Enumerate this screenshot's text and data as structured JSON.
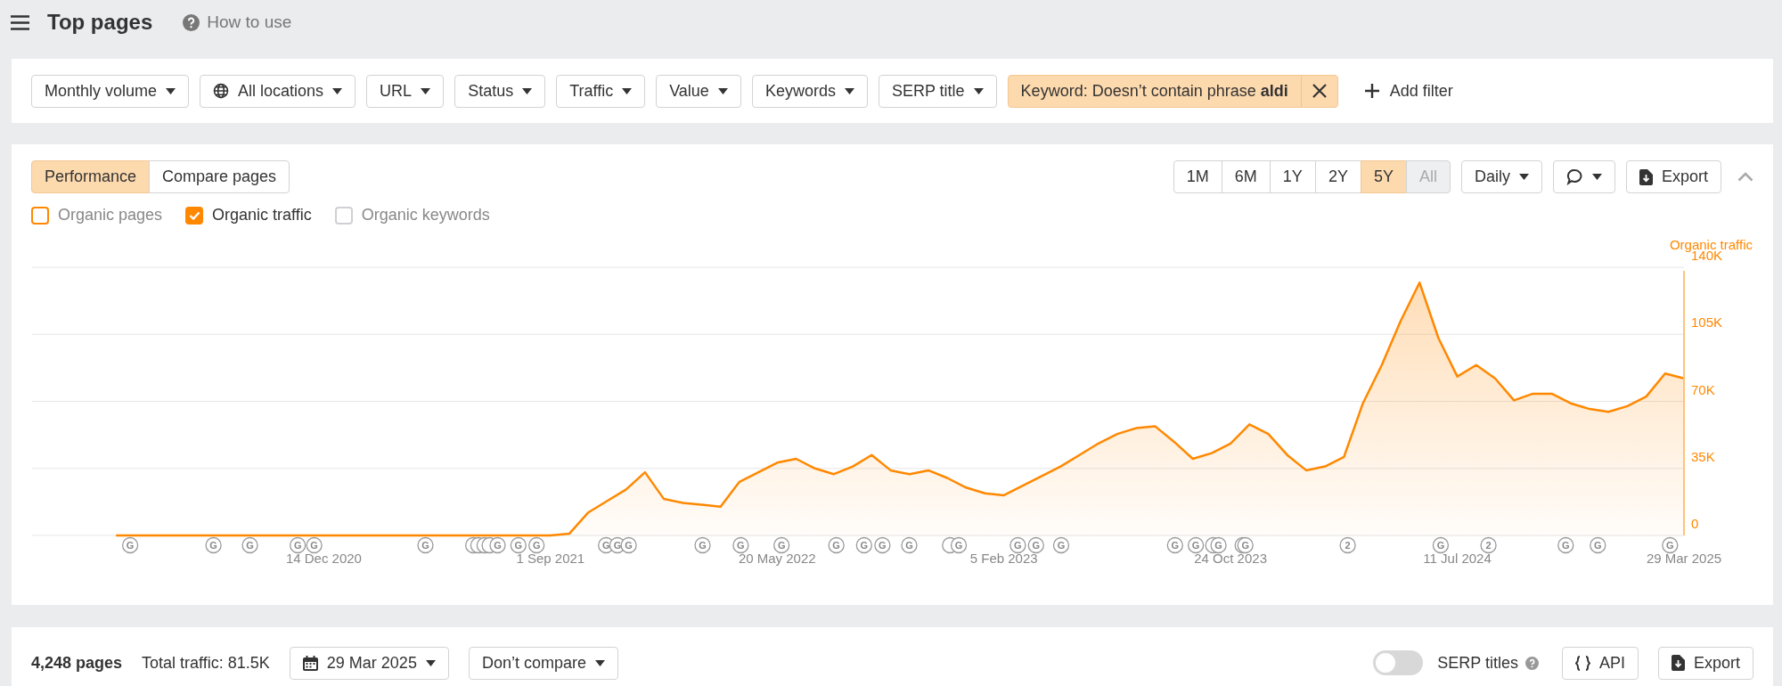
{
  "header": {
    "title": "Top pages",
    "help_link": "How to use"
  },
  "filters": [
    {
      "label": "Monthly volume",
      "kind": "dropdown"
    },
    {
      "label": "All locations",
      "kind": "location"
    },
    {
      "label": "URL",
      "kind": "dropdown"
    },
    {
      "label": "Status",
      "kind": "dropdown"
    },
    {
      "label": "Traffic",
      "kind": "dropdown"
    },
    {
      "label": "Value",
      "kind": "dropdown"
    },
    {
      "label": "Keywords",
      "kind": "dropdown"
    },
    {
      "label": "SERP title",
      "kind": "dropdown"
    }
  ],
  "active_filter": {
    "label": "Keyword: Doesn’t contain phrase **aldi**"
  },
  "add_filter": "Add filter",
  "view_tabs": [
    {
      "label": "Performance",
      "selected": true
    },
    {
      "label": "Compare pages",
      "selected": false
    }
  ],
  "ranges": [
    {
      "label": "1M",
      "selected": false,
      "disabled": false
    },
    {
      "label": "6M",
      "selected": false,
      "disabled": false
    },
    {
      "label": "1Y",
      "selected": false,
      "disabled": false
    },
    {
      "label": "2Y",
      "selected": false,
      "disabled": false
    },
    {
      "label": "5Y",
      "selected": true,
      "disabled": false
    },
    {
      "label": "All",
      "selected": false,
      "disabled": true
    }
  ],
  "interval": "Daily",
  "export": "Export",
  "metrics": [
    {
      "label": "Organic pages",
      "checked": false,
      "color": "#ff8800"
    },
    {
      "label": "Organic traffic",
      "checked": true,
      "color": "#ff8800"
    },
    {
      "label": "Organic keywords",
      "checked": false,
      "color": "#cfd0d3"
    }
  ],
  "chart_data": {
    "type": "area",
    "categories": [
      null,
      null,
      null,
      null,
      null,
      null,
      null,
      null,
      null,
      null,
      null,
      "14 Dec 2020",
      null,
      null,
      null,
      null,
      null,
      null,
      null,
      null,
      null,
      null,
      null,
      "1 Sep 2021",
      null,
      null,
      null,
      null,
      null,
      null,
      null,
      null,
      null,
      null,
      null,
      "20 May 2022",
      null,
      null,
      null,
      null,
      null,
      null,
      null,
      null,
      null,
      null,
      null,
      "5 Feb 2023",
      null,
      null,
      null,
      null,
      null,
      null,
      null,
      null,
      null,
      null,
      null,
      "24 Oct 2023",
      null,
      null,
      null,
      null,
      null,
      null,
      null,
      null,
      null,
      null,
      null,
      "11 Jul 2024",
      null,
      null,
      null,
      null,
      null,
      null,
      null,
      null,
      null,
      null,
      null,
      "29 Mar 2025"
    ],
    "series": [
      {
        "name": "Organic traffic",
        "color": "#ff8800",
        "values": [
          0,
          0,
          0,
          0,
          0,
          0,
          0,
          0,
          0,
          0,
          0,
          0,
          0,
          0,
          0,
          0,
          0,
          0,
          0,
          0,
          0,
          0,
          0,
          0,
          1000,
          12000,
          18000,
          24000,
          33000,
          19000,
          17000,
          16000,
          15000,
          28000,
          33000,
          38000,
          40000,
          35000,
          32000,
          36000,
          42000,
          34000,
          32000,
          34000,
          30000,
          25000,
          22000,
          21000,
          26000,
          31000,
          36000,
          42000,
          48000,
          53000,
          56000,
          57000,
          49000,
          40000,
          43000,
          48000,
          58000,
          53000,
          42000,
          34000,
          36000,
          41000,
          69000,
          89000,
          112000,
          132000,
          103000,
          83000,
          89000,
          82000,
          70500,
          74000,
          74000,
          69000,
          66000,
          64500,
          67500,
          72500,
          84500,
          82000
        ]
      }
    ],
    "ylim": [
      0,
      140000
    ],
    "grid": true,
    "yticks": [
      {
        "value": 0,
        "label": "0"
      },
      {
        "value": 35000,
        "label": "35K"
      },
      {
        "value": 70000,
        "label": "70K"
      },
      {
        "value": 105000,
        "label": "105K"
      },
      {
        "value": 140000,
        "label": "140K"
      }
    ]
  },
  "update_markers": [
    {
      "kind": "labeled",
      "text": "G"
    },
    {
      "kind": "labeled",
      "text": "G"
    },
    {
      "kind": "labeled",
      "text": "G"
    },
    {
      "kind": "labeled",
      "text": "G"
    },
    {
      "kind": "labeled",
      "text": "G"
    },
    {
      "kind": "labeled",
      "text": "G"
    },
    {
      "kind": "covered"
    },
    {
      "kind": "covered"
    },
    {
      "kind": "covered"
    },
    {
      "kind": "covered"
    },
    {
      "kind": "labeled",
      "text": "G"
    },
    {
      "kind": "labeled",
      "text": "G"
    },
    {
      "kind": "labeled",
      "text": "G"
    },
    {
      "kind": "labeled",
      "text": "G"
    },
    {
      "kind": "labeled",
      "text": "G"
    },
    {
      "kind": "labeled",
      "text": "G"
    },
    {
      "kind": "labeled",
      "text": "G"
    },
    {
      "kind": "labeled",
      "text": "G"
    },
    {
      "kind": "labeled",
      "text": "G"
    },
    {
      "kind": "labeled",
      "text": "G"
    },
    {
      "kind": "labeled",
      "text": "G"
    },
    {
      "kind": "labeled",
      "text": "G"
    },
    {
      "kind": "labeled",
      "text": "G"
    },
    {
      "kind": "covered"
    },
    {
      "kind": "labeled",
      "text": "G"
    },
    {
      "kind": "labeled",
      "text": "G"
    },
    {
      "kind": "labeled",
      "text": "G"
    },
    {
      "kind": "labeled",
      "text": "G"
    },
    {
      "kind": "labeled",
      "text": "G"
    },
    {
      "kind": "labeled",
      "text": "G"
    },
    {
      "kind": "covered"
    },
    {
      "kind": "labeled",
      "text": "G"
    },
    {
      "kind": "covered"
    },
    {
      "kind": "labeled",
      "text": "G"
    },
    {
      "kind": "labeled",
      "text": "2"
    },
    {
      "kind": "labeled",
      "text": "G"
    },
    {
      "kind": "labeled",
      "text": "2"
    },
    {
      "kind": "labeled",
      "text": "G"
    },
    {
      "kind": "labeled",
      "text": "G"
    },
    {
      "kind": "labeled",
      "text": "G"
    }
  ],
  "summary": {
    "pages": "4,248 pages",
    "total_traffic": "Total traffic: 81.5K",
    "date": "29 Mar 2025",
    "compare": "Don’t compare",
    "serp_titles": {
      "label": "SERP titles",
      "on": false
    },
    "api": "API",
    "export": "Export"
  }
}
